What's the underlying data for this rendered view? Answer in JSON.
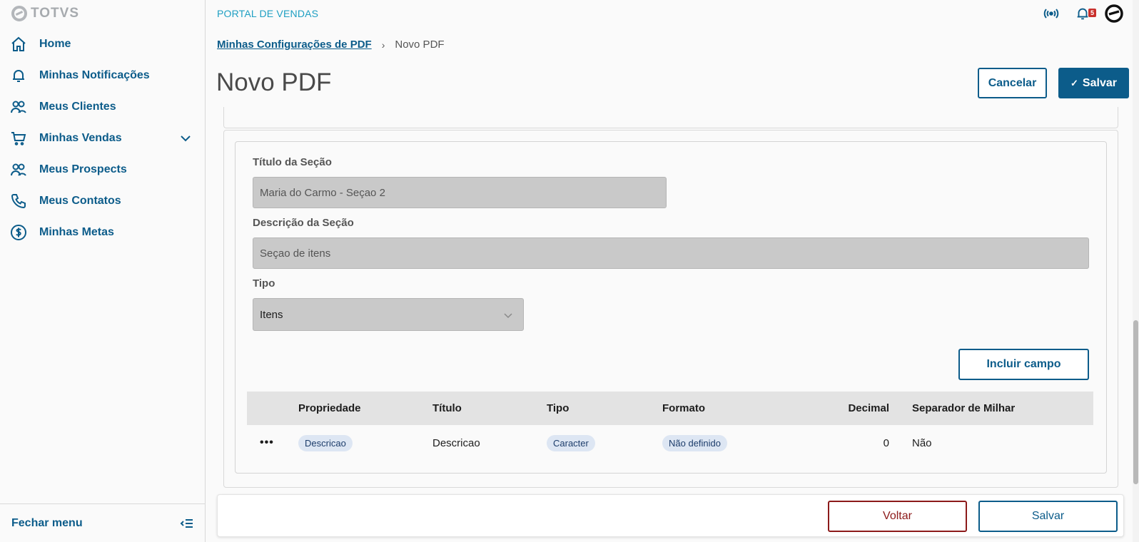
{
  "sidebar": {
    "logo": "TOTVS",
    "items": [
      {
        "label": "Home",
        "icon": "home-icon"
      },
      {
        "label": "Minhas Notificações",
        "icon": "bell-icon"
      },
      {
        "label": "Meus Clientes",
        "icon": "users-icon"
      },
      {
        "label": "Minhas Vendas",
        "icon": "cart-icon"
      },
      {
        "label": "Meus Prospects",
        "icon": "users-icon"
      },
      {
        "label": "Meus Contatos",
        "icon": "phone-icon"
      },
      {
        "label": "Minhas Metas",
        "icon": "dollar-icon"
      }
    ],
    "close_label": "Fechar menu"
  },
  "header": {
    "portal_name": "PORTAL DE VENDAS",
    "notification_count": "5",
    "breadcrumb": {
      "parent": "Minhas Configurações de PDF",
      "current": "Novo PDF"
    },
    "title": "Novo PDF",
    "cancel_label": "Cancelar",
    "save_label": "Salvar"
  },
  "section": {
    "title_label": "Título da Seção",
    "title_value": "Maria do Carmo - Seçao 2",
    "description_label": "Descrição da Seção",
    "description_value": "Seçao de itens",
    "type_label": "Tipo",
    "type_value": "Itens",
    "add_field_label": "Incluir campo"
  },
  "table": {
    "columns": [
      "Propriedade",
      "Título",
      "Tipo",
      "Formato",
      "Decimal",
      "Separador de Milhar"
    ],
    "rows": [
      {
        "propriedade": "Descricao",
        "titulo": "Descricao",
        "tipo": "Caracter",
        "formato": "Não definido",
        "decimal": "0",
        "separador": "Não"
      }
    ]
  },
  "footer": {
    "back_label": "Voltar",
    "save_label": "Salvar"
  },
  "colors": {
    "primary": "#0c5c8a",
    "danger": "#8c1a1a",
    "accent": "#1e9fc2"
  }
}
